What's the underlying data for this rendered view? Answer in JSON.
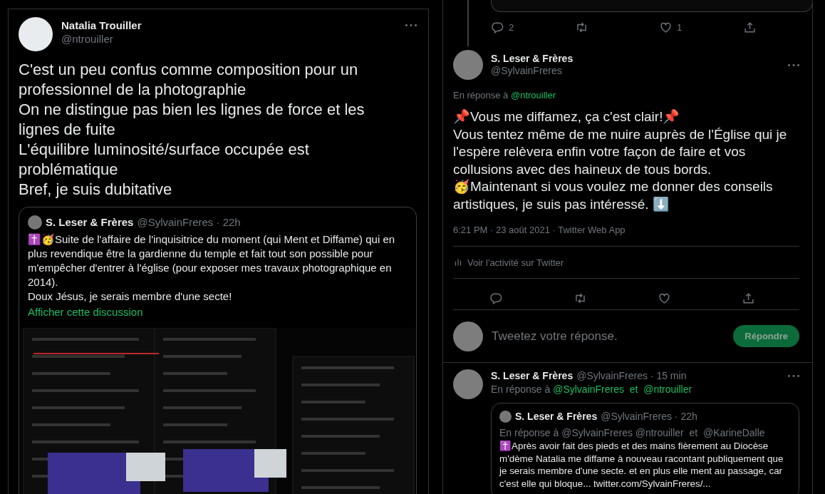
{
  "left_tweet": {
    "author_name": "Natalia Trouiller",
    "author_handle": "@ntrouiller",
    "text": "C'est un peu confus comme composition pour un professionnel de la photographie\nOn ne distingue pas bien les lignes de force et les lignes de fuite\nL'équilibre luminosité/surface occupée est problématique\nBref, je suis dubitative",
    "quote": {
      "author_name": "S. Leser & Frères",
      "handle_time": "@SylvainFreres · 22h",
      "text": "✝️🥳Suite de l'affaire de l'inquisitrice du moment (qui Ment et Diffame) qui en plus revendique être la gardienne du temple et fait tout son possible pour m'empêcher d'entrer à l'église (pour exposer mes travaux photographique en 2014).\nDoux Jésus, je serais membre d'une secte!",
      "link": "Afficher cette discussion"
    }
  },
  "right_panel": {
    "previous_actions": [
      {
        "kind": "reply",
        "count": "2"
      },
      {
        "kind": "retweet"
      },
      {
        "kind": "like",
        "count": "1"
      },
      {
        "kind": "share"
      }
    ],
    "main_tweet": {
      "author_name": "S. Leser & Frères",
      "author_handle": "@SylvainFreres",
      "reply_to_label": "En réponse à",
      "reply_to": "@ntrouiller",
      "text": "📌Vous me diffamez, ça c'est clair!📌\nVous tentez même de me nuire auprès de l'Église qui je l'espère relèvera enfin votre façon de faire et vos collusions avec des haineux de tous bords.\n🥳Maintenant si vous voulez me donner des conseils artistiques, je suis pas intéressé. ⬇️",
      "meta": "6:21 PM · 23 août 2021 · Twitter Web App",
      "activity_link": "Voir l'activité sur Twitter",
      "actions": [
        {
          "kind": "reply"
        },
        {
          "kind": "retweet"
        },
        {
          "kind": "like"
        },
        {
          "kind": "share"
        }
      ]
    },
    "composer": {
      "placeholder": "Tweetez votre réponse.",
      "button": "Répondre"
    },
    "reply_tweet": {
      "author_name": "S. Leser & Frères",
      "handle_time": "@SylvainFreres · 15 min",
      "reply_to_label": "En réponse à",
      "reply_to": "@SylvainFreres  et  @ntrouiller",
      "quote": {
        "author_name": "S. Leser & Frères",
        "handle_time": "@SylvainFreres · 22h",
        "reply_to_text": "En réponse à @SylvainFreres @ntrouiller  et  @KarineDalle",
        "text": "✝️Après avoir fait des pieds et des mains fièrement au Diocèse m'dème Natalia me diffame à nouveau racontant publiquement que je serais membre d'une secte. et en plus elle ment au passage, car c'est elle qui bloque... twitter.com/SylvainFreres/..."
      }
    }
  }
}
